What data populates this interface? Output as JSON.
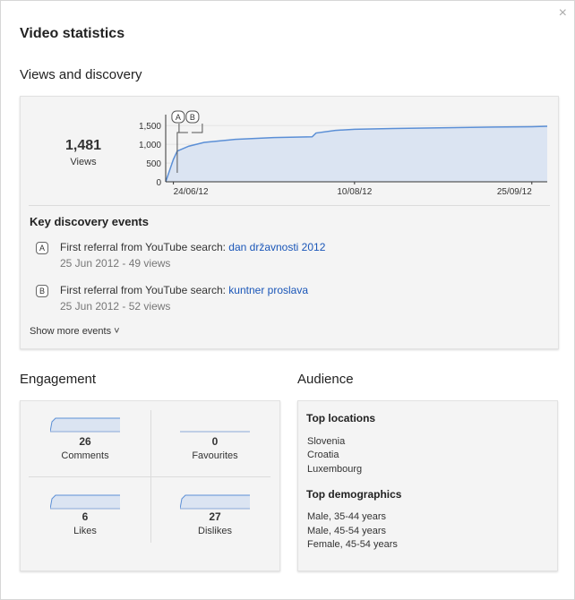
{
  "dialog": {
    "title": "Video statistics",
    "close_glyph": "×"
  },
  "views": {
    "heading": "Views and discovery",
    "total": "1,481",
    "total_label": "Views",
    "chart_data": {
      "type": "area",
      "x": [
        "2012-06-22",
        "2012-06-24",
        "2012-06-25",
        "2012-06-28",
        "2012-07-02",
        "2012-07-10",
        "2012-07-20",
        "2012-07-30",
        "2012-07-31",
        "2012-08-05",
        "2012-08-10",
        "2012-08-20",
        "2012-09-01",
        "2012-09-15",
        "2012-09-25",
        "2012-09-29"
      ],
      "values": [
        0,
        600,
        820,
        950,
        1050,
        1130,
        1180,
        1200,
        1300,
        1370,
        1400,
        1420,
        1440,
        1460,
        1470,
        1481
      ],
      "ylim": [
        0,
        1600
      ],
      "yticks": [
        "0",
        "500",
        "1,000",
        "1,500"
      ],
      "xticks": [
        "24/06/12",
        "10/08/12",
        "25/09/12"
      ],
      "markers": [
        "A",
        "B"
      ],
      "color": "#5b8fd6",
      "fill": "#dbe4f2",
      "grid": true
    },
    "discovery_title": "Key discovery events",
    "events": [
      {
        "badge": "A",
        "text": "First referral from YouTube search: ",
        "link": "dan državnosti 2012",
        "sub": "25 Jun 2012 - 49 views"
      },
      {
        "badge": "B",
        "text": "First referral from YouTube search: ",
        "link": "kuntner proslava",
        "sub": "25 Jun 2012 - 52 views"
      }
    ],
    "show_more": "Show more events ˅"
  },
  "engagement": {
    "heading": "Engagement",
    "cells": [
      {
        "num": "26",
        "label": "Comments",
        "level": 0.75
      },
      {
        "num": "0",
        "label": "Favourites",
        "level": 0.0
      },
      {
        "num": "6",
        "label": "Likes",
        "level": 0.75
      },
      {
        "num": "27",
        "label": "Dislikes",
        "level": 0.75
      }
    ]
  },
  "audience": {
    "heading": "Audience",
    "locations_title": "Top locations",
    "locations": [
      "Slovenia",
      "Croatia",
      "Luxembourg"
    ],
    "demographics_title": "Top demographics",
    "demographics": [
      "Male, 35-44 years",
      "Male, 45-54 years",
      "Female, 45-54 years"
    ]
  }
}
